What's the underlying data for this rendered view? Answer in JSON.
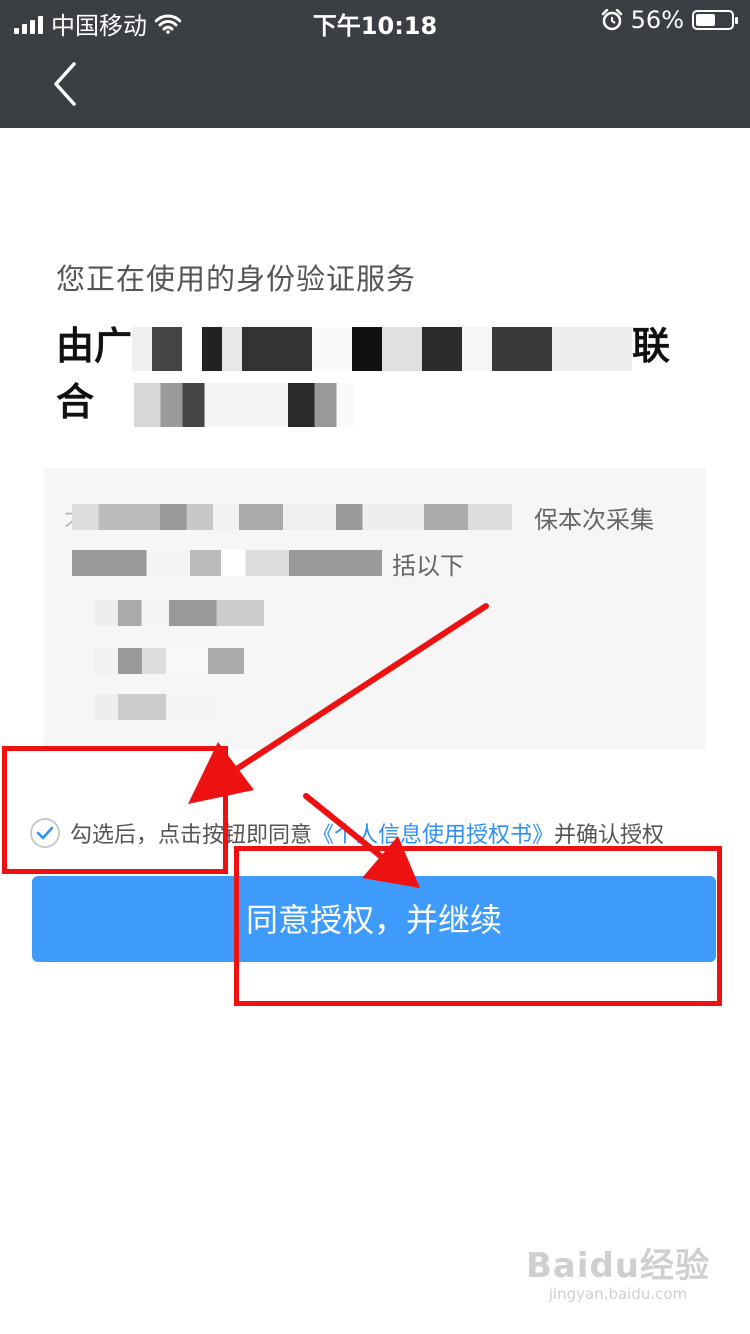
{
  "status_bar": {
    "carrier": "中国移动",
    "time": "下午10:18",
    "battery_percent": "56%",
    "battery_level": 0.56,
    "icons": [
      "signal-icon",
      "wifi-icon",
      "alarm-icon",
      "battery-icon"
    ]
  },
  "nav": {
    "back_icon": "chevron-left-icon"
  },
  "header": {
    "subtitle": "您正在使用的身份验证服务",
    "provider_line1_prefix": "由广",
    "provider_line1_suffix": "联",
    "provider_line2_prefix": "合"
  },
  "info_box": {
    "visible_prefix": "才",
    "visible_tail1": "保本次采集",
    "visible_tail2": "括以下"
  },
  "consent": {
    "checked": true,
    "text_before": "勾选后，点击按钮即同意",
    "link_text": "《个人信息使用授权书》",
    "text_after": "并确认授权"
  },
  "primary_button": {
    "label": "同意授权，并继续"
  },
  "watermark": {
    "logo_text": "Baidu经验",
    "sub_text": "jingyan.baidu.com"
  },
  "colors": {
    "status_bar_bg": "#3b3e42",
    "primary_blue": "#3e9bfb",
    "link_blue": "#2f8ff5",
    "annotation_red": "#ee1111"
  }
}
